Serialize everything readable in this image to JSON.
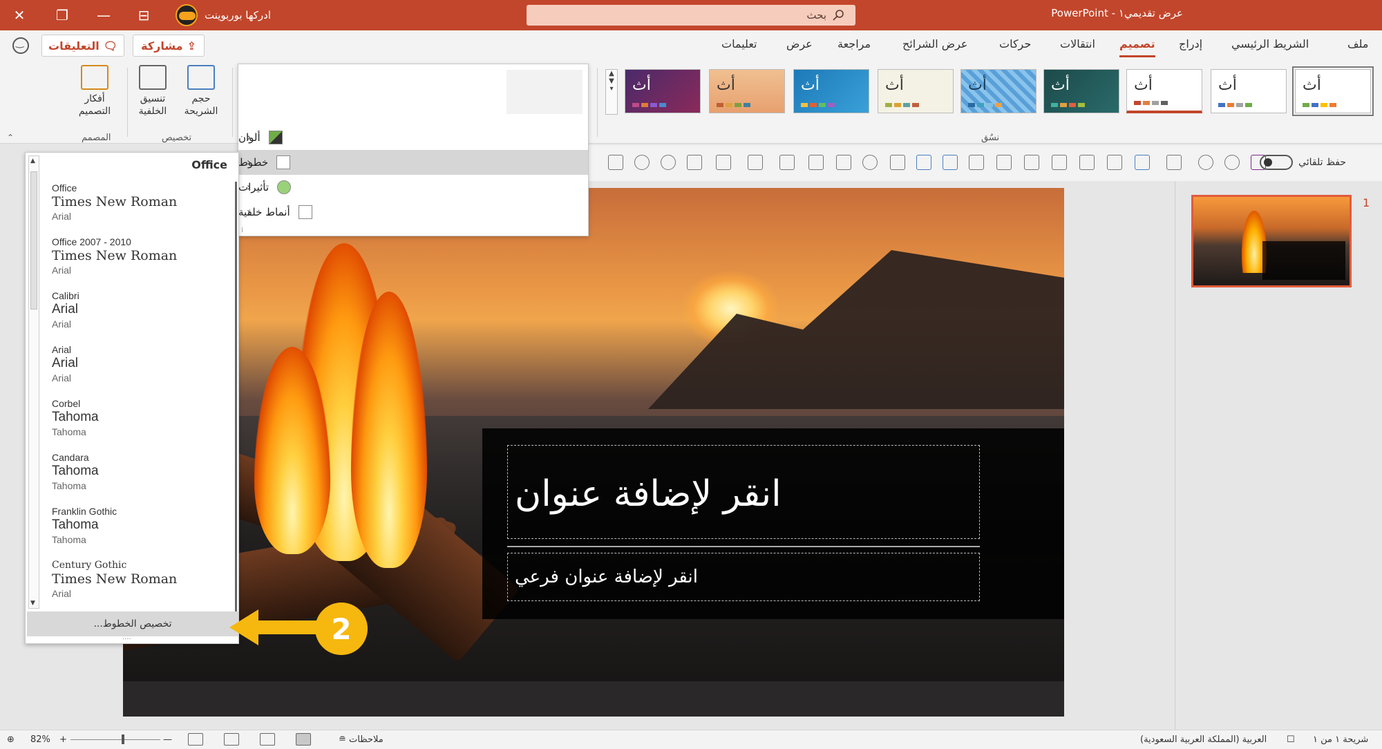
{
  "titlebar": {
    "brand_name": "ادركها بوربوينت",
    "search_placeholder": "بحث",
    "document_title": "عرض تقديمي١ - PowerPoint",
    "close_glyph": "✕",
    "restore_glyph": "❐",
    "minimize_glyph": "—",
    "ribbon_display_glyph": "⊟"
  },
  "tabs": {
    "file": "ملف",
    "home": "الشريط الرئيسي",
    "insert": "إدراج",
    "design": "تصميم",
    "transitions": "انتقالات",
    "animations": "حركات",
    "slideshow": "عرض الشرائح",
    "review": "مراجعة",
    "view": "عرض",
    "help": "تعليمات",
    "share": "مشاركة",
    "comments": "التعليقات"
  },
  "ribbon": {
    "slide_size": "حجم الشريحة",
    "format_background": "تنسيق الخلفية",
    "design_ideas": "أفكار التصميم",
    "group_customize": "تخصيص",
    "group_designer": "المصمم",
    "group_themes": "نسُق",
    "theme_label": "أث"
  },
  "format_bar": {
    "autosave": "حفظ تلقائي"
  },
  "variants_menu": {
    "items": [
      {
        "label": "ألوان",
        "icon": "colors-icon"
      },
      {
        "label": "خطوط",
        "icon": "fonts-icon"
      },
      {
        "label": "تأثيرات",
        "icon": "effects-icon"
      },
      {
        "label": "أنماط خلفية",
        "icon": "background-styles-icon"
      }
    ]
  },
  "fonts_menu": {
    "header": "Office",
    "items": [
      {
        "name": "Office",
        "heading": "Times New Roman",
        "body": "Arial"
      },
      {
        "name": "Office 2007 - 2010",
        "heading": "Times New Roman",
        "body": "Arial"
      },
      {
        "name": "Calibri",
        "heading": "Arial",
        "body": "Arial"
      },
      {
        "name": "Arial",
        "heading": "Arial",
        "body": "Arial"
      },
      {
        "name": "Corbel",
        "heading": "Tahoma",
        "body": "Tahoma"
      },
      {
        "name": "Candara",
        "heading": "Tahoma",
        "body": "Tahoma"
      },
      {
        "name": "Franklin Gothic",
        "heading": "Tahoma",
        "body": "Tahoma"
      },
      {
        "name": "Century Gothic",
        "heading": "Times New Roman",
        "body": "Arial"
      }
    ],
    "customize": "تخصيص الخطوط..."
  },
  "slide": {
    "title_placeholder": "انقر لإضافة عنوان",
    "subtitle_placeholder": "انقر لإضافة عنوان فرعي"
  },
  "thumbnails": {
    "slide_number": "1"
  },
  "annotation": {
    "step": "2"
  },
  "statusbar": {
    "slide_of": "شريحة ١ من ١",
    "language": "العربية (المملكة العربية السعودية)",
    "notes": "ملاحظات",
    "zoom": "82%",
    "zoom_minus": "—",
    "zoom_plus": "+"
  },
  "colors": {
    "accent": "#c2462b",
    "callout": "#f6b80f"
  }
}
